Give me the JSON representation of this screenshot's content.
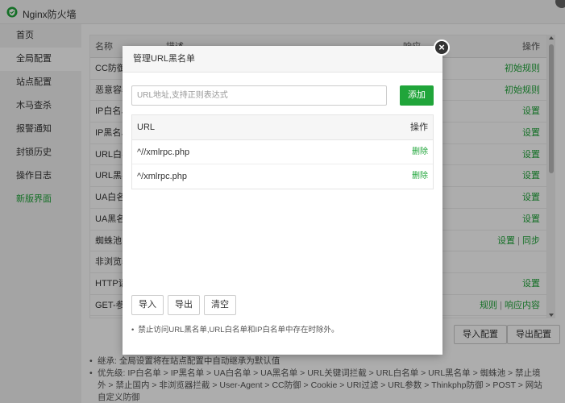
{
  "window": {
    "title": "Nginx防火墙"
  },
  "sidebar": {
    "items": [
      {
        "label": "首页"
      },
      {
        "label": "全局配置"
      },
      {
        "label": "站点配置"
      },
      {
        "label": "木马查杀"
      },
      {
        "label": "报警通知"
      },
      {
        "label": "封锁历史"
      },
      {
        "label": "操作日志"
      },
      {
        "label": "新版界面"
      }
    ]
  },
  "table": {
    "headers": {
      "name": "名称",
      "desc": "描述",
      "status": "响应",
      "ops": "操作"
    },
    "rows": [
      {
        "name": "CC防御",
        "ops": [
          "初始规则"
        ]
      },
      {
        "name": "恶意容器",
        "ops": [
          "初始规则"
        ]
      },
      {
        "name": "IP白名单",
        "ops": [
          "设置"
        ]
      },
      {
        "name": "IP黑名单",
        "ops": [
          "设置"
        ]
      },
      {
        "name": "URL白名单",
        "ops": [
          "设置"
        ]
      },
      {
        "name": "URL黑名单",
        "ops": [
          "设置"
        ]
      },
      {
        "name": "UA白名单",
        "ops": [
          "设置"
        ]
      },
      {
        "name": "UA黑名单",
        "ops": [
          "设置"
        ]
      },
      {
        "name": "蜘蛛池",
        "ops": [
          "设置",
          "同步"
        ]
      },
      {
        "name": "非浏览器",
        "ops": []
      },
      {
        "name": "HTTP请求",
        "ops": [
          "设置"
        ]
      },
      {
        "name": "GET-参数",
        "ops": [
          "规则",
          "响应内容"
        ]
      }
    ]
  },
  "actions": {
    "import_config": "导入配置",
    "export_config": "导出配置"
  },
  "notes": [
    "继承: 全局设置将在站点配置中自动继承为默认值",
    "优先级: IP白名单 > IP黑名单 > UA白名单 > UA黑名单 > URL关键词拦截 > URL白名单 > URL黑名单 > 蜘蛛池 > 禁止境外 > 禁止国内 > 非浏览器拦截 > User-Agent > CC防御 > Cookie > URI过滤 > URL参数 > Thinkphp防御 > POST > 网站自定义防御"
  ],
  "modal": {
    "title": "管理URL黑名单",
    "input_placeholder": "URL地址,支持正则表达式",
    "add_label": "添加",
    "col_url": "URL",
    "col_ops": "操作",
    "rows": [
      {
        "url": "^//xmlrpc.php",
        "action": "删除"
      },
      {
        "url": "^/xmlrpc.php",
        "action": "删除"
      }
    ],
    "import_label": "导入",
    "export_label": "导出",
    "clear_label": "清空",
    "note": "禁止访问URL黑名单,URL白名单和IP白名单中存在时除外。",
    "close_glyph": "×"
  },
  "colors": {
    "accent": "#20a53a",
    "overlay": "rgba(0,0,0,0.32)"
  }
}
